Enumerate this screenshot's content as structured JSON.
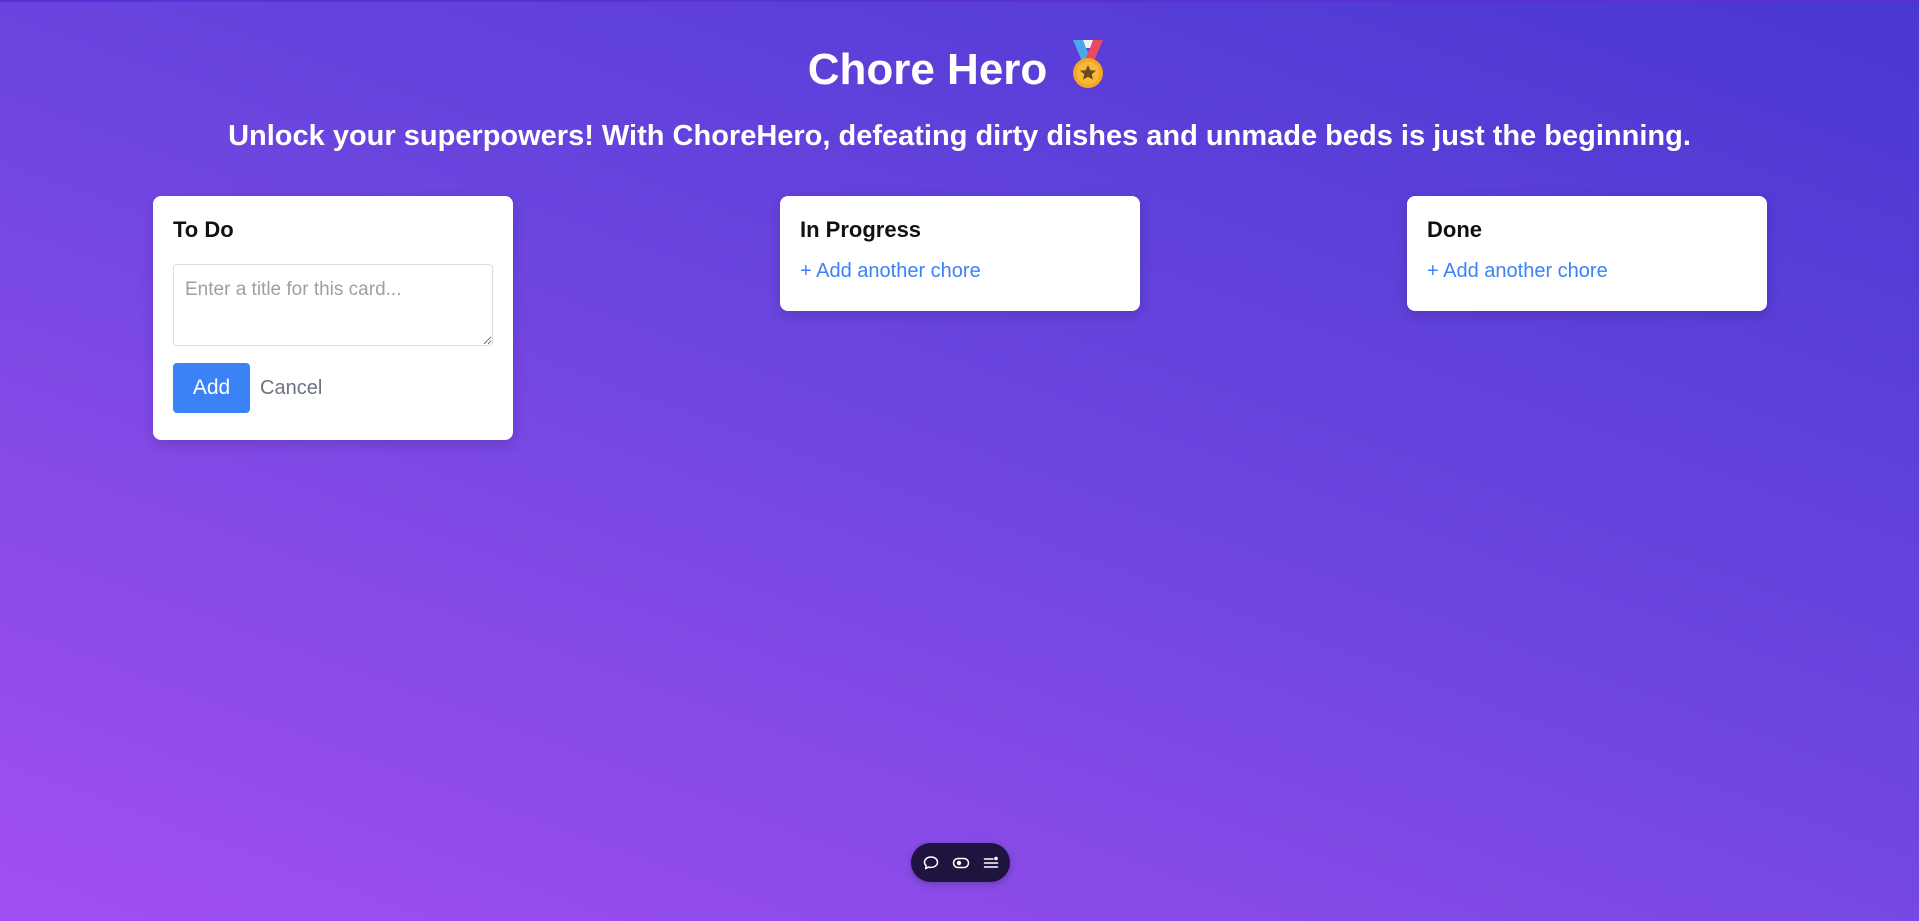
{
  "header": {
    "title": "Chore Hero",
    "title_icon": "medal-icon",
    "subtitle": "Unlock your superpowers! With ChoreHero, defeating dirty dishes and unmade beds is just the beginning."
  },
  "columns": [
    {
      "title": "To Do",
      "composer": {
        "placeholder": "Enter a title for this card...",
        "value": "",
        "add_label": "Add",
        "cancel_label": "Cancel"
      }
    },
    {
      "title": "In Progress",
      "add_link": "+ Add another chore"
    },
    {
      "title": "Done",
      "add_link": "+ Add another chore"
    }
  ],
  "toolbar": {
    "icons": [
      "comment-icon",
      "toggle-view-icon",
      "menu-settings-icon"
    ]
  },
  "colors": {
    "accent": "#3b82f6",
    "background_start": "#4a37d1",
    "background_end": "#a24ff2",
    "toolbar": "#1f1440"
  }
}
